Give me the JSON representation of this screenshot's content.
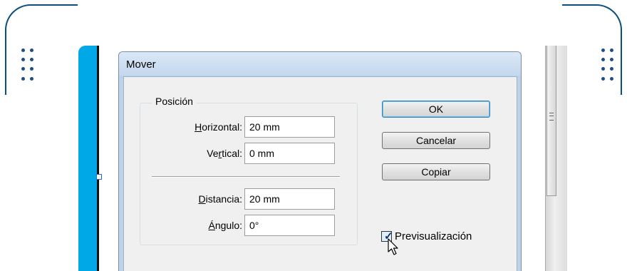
{
  "dialog": {
    "title": "Mover",
    "position_group": {
      "label": "Posición",
      "horizontal": {
        "label_pre": "",
        "label_key": "H",
        "label_post": "orizontal:",
        "value": "20 mm"
      },
      "vertical": {
        "label_pre": "Ve",
        "label_key": "r",
        "label_post": "tical:",
        "value": "0 mm"
      },
      "distance": {
        "label_pre": "",
        "label_key": "D",
        "label_post": "istancia:",
        "value": "20 mm"
      },
      "angle": {
        "label_pre": "",
        "label_key": "Á",
        "label_post": "ngulo:",
        "value": "0°"
      }
    },
    "buttons": {
      "ok": "OK",
      "cancel": "Cancelar",
      "copy": "Copiar"
    },
    "preview": {
      "label": "Previsualización",
      "checked": true
    }
  },
  "colors": {
    "accent_blue": "#00a8e8",
    "frame_navy": "#0a4f7a",
    "dot_blue": "#1d4f86",
    "titlebar": "#c3d7ee",
    "dialog_body": "#f0f0f0"
  },
  "icons": [
    "mouse-cursor-icon",
    "scrollbar-grip-icon",
    "checkmark-icon"
  ]
}
